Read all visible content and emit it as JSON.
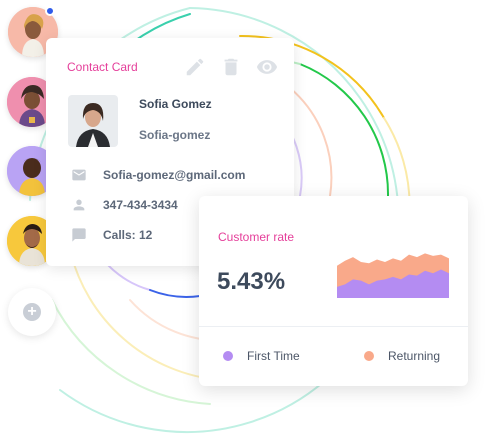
{
  "contact_card": {
    "title": "Contact Card",
    "name": "Sofia Gomez",
    "handle": "Sofia-gomez",
    "email": "Sofia-gomez@gmail.com",
    "phone": "347-434-3434",
    "calls": "Calls: 12",
    "action_icons": [
      "edit-icon",
      "delete-icon",
      "view-icon"
    ]
  },
  "customer_rate": {
    "title": "Customer rate",
    "value": "5.43%",
    "legend": [
      {
        "label": "First Time",
        "color": "#b48cf2"
      },
      {
        "label": "Returning",
        "color": "#f9a98a"
      }
    ]
  },
  "chart_data": {
    "type": "area",
    "series": [
      {
        "name": "Returning",
        "values": [
          52,
          60,
          66,
          58,
          56,
          62,
          58,
          64,
          60,
          70,
          66,
          72,
          68,
          70,
          64
        ]
      },
      {
        "name": "First Time",
        "values": [
          18,
          22,
          30,
          28,
          22,
          28,
          30,
          34,
          30,
          38,
          36,
          44,
          40,
          46,
          40
        ]
      }
    ],
    "ylim": [
      0,
      100
    ]
  },
  "colors": {
    "accent_pink": "#e53f9a",
    "primary_text": "#3d4a5c",
    "online_indicator": "#2f5bea"
  },
  "sidebar": {
    "avatars": [
      "avatar-1",
      "avatar-2",
      "avatar-3",
      "avatar-4"
    ],
    "add_icon": "plus-icon"
  }
}
